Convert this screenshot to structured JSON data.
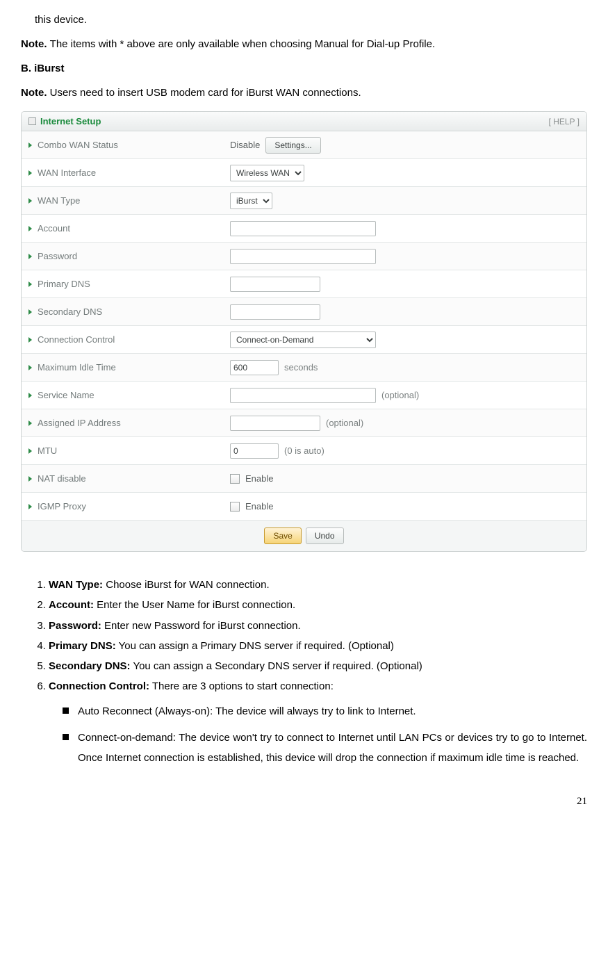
{
  "intro_fragment": "this device.",
  "note1_pre": "Note. ",
  "note1_body": "The items with * above are only available when choosing Manual for Dial-up Profile.",
  "sectionB": "B.  iBurst",
  "note2_pre": "Note. ",
  "note2_body": "Users need to insert USB modem card for iBurst WAN connections.",
  "panel": {
    "title": "Internet Setup",
    "help": "[ HELP ]",
    "rows": {
      "combo_label": "Combo WAN Status",
      "combo_status": "Disable",
      "combo_btn": "Settings...",
      "wan_iface_label": "WAN Interface",
      "wan_iface_value": "Wireless WAN",
      "wan_type_label": "WAN Type",
      "wan_type_value": "iBurst",
      "account_label": "Account",
      "password_label": "Password",
      "pdns_label": "Primary DNS",
      "sdns_label": "Secondary DNS",
      "conn_label": "Connection Control",
      "conn_value": "Connect-on-Demand",
      "idle_label": "Maximum Idle Time",
      "idle_value": "600",
      "idle_unit": "seconds",
      "svc_label": "Service Name",
      "svc_hint": "(optional)",
      "aip_label": "Assigned IP Address",
      "aip_hint": "(optional)",
      "mtu_label": "MTU",
      "mtu_value": "0",
      "mtu_hint": "(0 is auto)",
      "nat_label": "NAT disable",
      "nat_opt": "Enable",
      "igmp_label": "IGMP Proxy",
      "igmp_opt": "Enable"
    },
    "save": "Save",
    "undo": "Undo"
  },
  "list": {
    "i1b": "WAN Type:",
    "i1": " Choose iBurst for WAN connection.",
    "i2b": "Account:",
    "i2": " Enter the User Name for iBurst connection.",
    "i3b": "Password:",
    "i3": " Enter new Password for iBurst connection.",
    "i4b": "Primary DNS:",
    "i4": " You can assign a Primary DNS server if required. (Optional)",
    "i5b": "Secondary DNS:",
    "i5": " You can assign a Secondary DNS server if required. (Optional)",
    "i6b": "Connection Control:",
    "i6": " There are 3 options to start connection:",
    "s1": "Auto Reconnect (Always-on): The device will always try to link to Internet.",
    "s2": "Connect-on-demand: The device won't try to connect to Internet until LAN PCs or devices try to go to Internet. Once Internet connection is established, this device will drop the connection if maximum idle time is reached."
  },
  "page": "21"
}
